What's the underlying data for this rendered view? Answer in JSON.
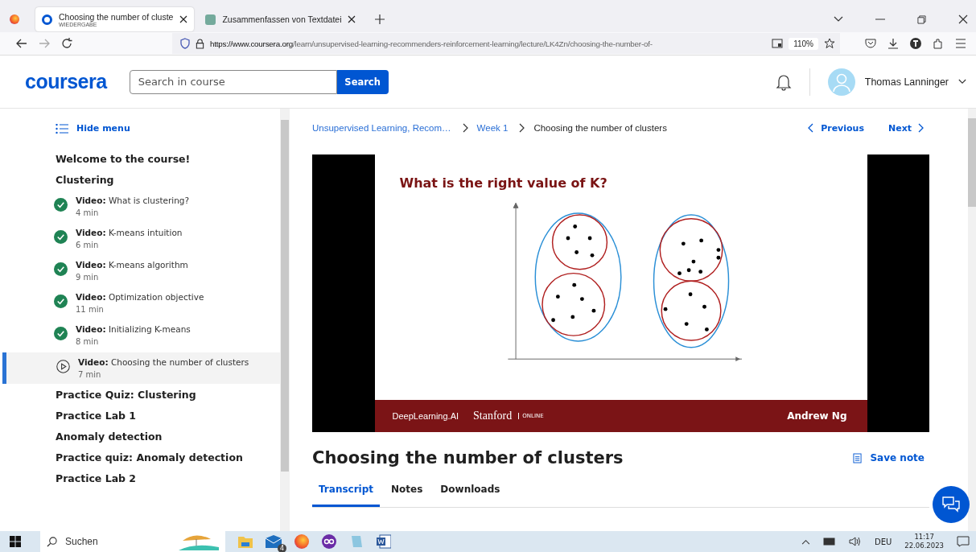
{
  "browser": {
    "tabs": [
      {
        "title": "Choosing the number of cluste",
        "subtitle": "WIEDERGABE",
        "selected": true
      },
      {
        "title": "Zusammenfassen von Textdatei",
        "selected": false
      }
    ],
    "url_host": "https://www.coursera.org",
    "url_path": "/learn/unsupervised-learning-recommenders-reinforcement-learning/lecture/LK4Zn/choosing-the-number-of-",
    "zoom": "110%"
  },
  "header": {
    "logo": "coursera",
    "search": {
      "placeholder": "Search in course",
      "button": "Search"
    },
    "user": "Thomas Lanninger"
  },
  "sidebar": {
    "hide_menu": "Hide menu",
    "items": [
      {
        "kind": "section",
        "label": "Welcome to the course!"
      },
      {
        "kind": "section",
        "label": "Clustering"
      },
      {
        "kind": "video",
        "type": "Video:",
        "label": "What is clustering?",
        "duration": "4 min",
        "completed": true,
        "selected": false
      },
      {
        "kind": "video",
        "type": "Video:",
        "label": "K-means intuition",
        "duration": "6 min",
        "completed": true,
        "selected": false
      },
      {
        "kind": "video",
        "type": "Video:",
        "label": "K-means algorithm",
        "duration": "9 min",
        "completed": true,
        "selected": false
      },
      {
        "kind": "video",
        "type": "Video:",
        "label": "Optimization objective",
        "duration": "11 min",
        "completed": true,
        "selected": false
      },
      {
        "kind": "video",
        "type": "Video:",
        "label": "Initializing K-means",
        "duration": "8 min",
        "completed": true,
        "selected": false
      },
      {
        "kind": "video",
        "type": "Video:",
        "label": "Choosing the number of clusters",
        "duration": "7 min",
        "completed": false,
        "selected": true
      },
      {
        "kind": "section",
        "label": "Practice Quiz: Clustering"
      },
      {
        "kind": "section",
        "label": "Practice Lab 1"
      },
      {
        "kind": "section",
        "label": "Anomaly detection"
      },
      {
        "kind": "section",
        "label": "Practice quiz: Anomaly detection"
      },
      {
        "kind": "section",
        "label": "Practice Lab 2"
      }
    ]
  },
  "breadcrumb": [
    "Unsupervised Learning, Recom…",
    "Week 1",
    "Choosing the number of clusters"
  ],
  "nav": {
    "previous": "Previous",
    "next": "Next"
  },
  "video_slide": {
    "title": "What is the right value of K?",
    "brand": "DeepLearning.AI",
    "university": "Stanford",
    "university_tag": "ONLINE",
    "presenter": "Andrew Ng"
  },
  "lecture_title": "Choosing the number of clusters",
  "save_note": "Save note",
  "content_tabs": [
    {
      "label": "Transcript",
      "selected": true
    },
    {
      "label": "Notes",
      "selected": false
    },
    {
      "label": "Downloads",
      "selected": false
    }
  ],
  "taskbar": {
    "search_placeholder": "Suchen",
    "mail_badge": "4",
    "language": "DEU",
    "time": "11:17",
    "date": "22.06.2023"
  }
}
